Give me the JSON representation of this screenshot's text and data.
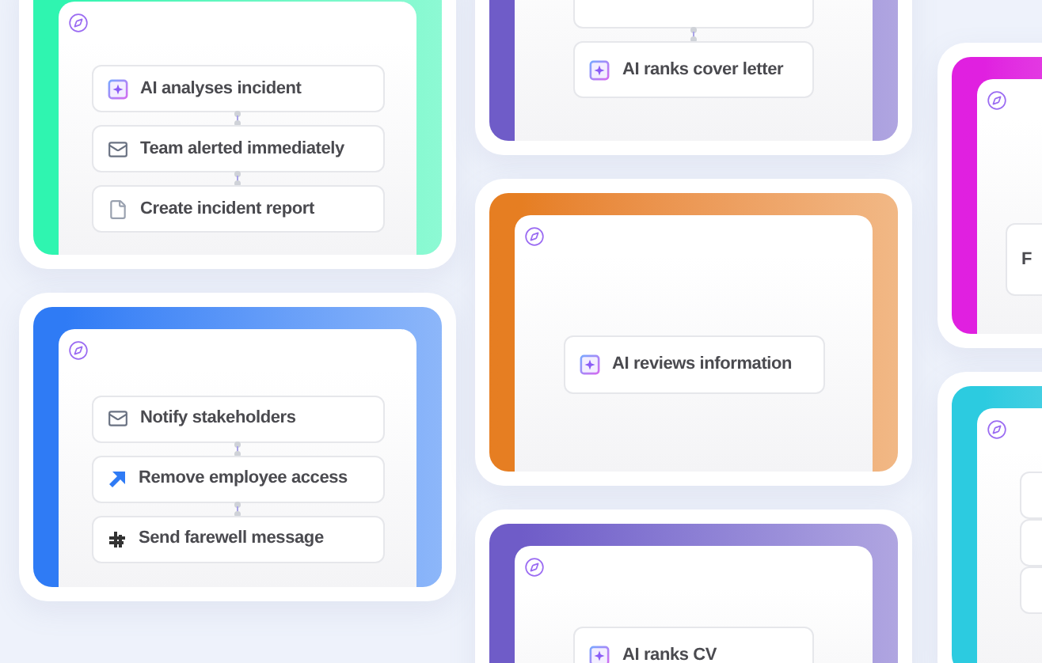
{
  "columns": [
    {
      "cards": [
        {
          "color": "#2ff5b0",
          "kind": "steps",
          "steps": [
            {
              "kind": "ai",
              "text": "AI analyses incident"
            },
            {
              "kind": "mail",
              "text": "Team alerted immediately"
            },
            {
              "kind": "document",
              "text": "Create incident report"
            }
          ]
        },
        {
          "color": "#2f7bf5",
          "kind": "steps",
          "steps": [
            {
              "kind": "mail",
              "text": "Notify stakeholders"
            },
            {
              "kind": "arrows",
              "text": "Remove employee access"
            },
            {
              "kind": "hash",
              "text": "Send farewell message"
            }
          ]
        }
      ]
    },
    {
      "cards": [
        {
          "color": "#6f5cc8",
          "kind": "steps_clipped_above",
          "steps": [
            {
              "kind": "ai",
              "text": "AI ranks cover letter"
            }
          ]
        },
        {
          "color": "#e67e22",
          "kind": "steps",
          "steps": [
            {
              "kind": "ai",
              "text": "AI reviews information"
            }
          ]
        },
        {
          "color": "#6f5cc8",
          "kind": "steps",
          "steps": [
            {
              "kind": "ai",
              "text": "AI ranks CV"
            }
          ]
        }
      ]
    },
    {
      "cards": [
        {
          "color": "#e020e0",
          "kind": "steps",
          "steps": [
            {
              "kind": "plain",
              "text": "F"
            }
          ]
        },
        {
          "color": "#2ccbe0",
          "kind": "blank_steps"
        }
      ]
    }
  ]
}
